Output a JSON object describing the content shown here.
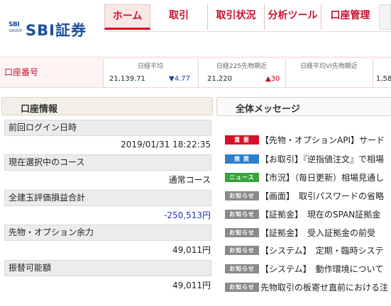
{
  "brand": {
    "mark_text": "SBI",
    "group_text": "GROUP",
    "name": "SBI証券"
  },
  "tabs": [
    {
      "label": "ホーム",
      "active": true
    },
    {
      "label": "取引",
      "active": false
    },
    {
      "label": "取引状況",
      "active": false
    },
    {
      "label": "分析ツール",
      "active": false
    },
    {
      "label": "口座管理",
      "active": false
    }
  ],
  "account": {
    "label": "口座番号"
  },
  "markets": [
    {
      "name": "日経平均",
      "value": "21,139.71",
      "change": "▼4.77",
      "dir": "down"
    },
    {
      "name": "日経225先物期近",
      "value": "21,220",
      "change": "▲30",
      "dir": "up"
    },
    {
      "name": "日経平均VI先物期近",
      "value": "",
      "change": "",
      "dir": ""
    },
    {
      "name": "",
      "value": "1,58",
      "change": "",
      "dir": ""
    }
  ],
  "account_info": {
    "title": "口座情報",
    "rows": [
      {
        "label": "前回ログイン日時",
        "value": "2019/01/31 18:22:35",
        "neg": false
      },
      {
        "label": "現在選択中のコース",
        "value": "通常コース",
        "neg": false
      },
      {
        "label": "全建玉評価損益合計",
        "value": "-250,513円",
        "neg": true
      },
      {
        "label": "先物・オプション余力",
        "value": "49,011円",
        "neg": false
      },
      {
        "label": "振替可能額",
        "value": "49,011円",
        "neg": false
      }
    ]
  },
  "messages": {
    "title": "全体メッセージ",
    "items": [
      {
        "badge": "重 要",
        "badge_color": "#d8102a",
        "text": "【先物・オプションAPI】サード"
      },
      {
        "badge": "推 奨",
        "badge_color": "#2a7fce",
        "text": "【お取引】『逆指値注文』で相場"
      },
      {
        "badge": "ニュース",
        "badge_color": "#3aa23a",
        "text": "【市況】（毎日更新）相場見通し"
      },
      {
        "badge": "お知らせ",
        "badge_color": "#8a8a8a",
        "text": "【画面】　取引パスワードの省略"
      },
      {
        "badge": "お知らせ",
        "badge_color": "#8a8a8a",
        "text": "【証拠金】　現在のSPAN証拠金"
      },
      {
        "badge": "お知らせ",
        "badge_color": "#8a8a8a",
        "text": "【証拠金】　受入証拠金の前受"
      },
      {
        "badge": "お知らせ",
        "badge_color": "#8a8a8a",
        "text": "【システム】　定期・臨時システ"
      },
      {
        "badge": "お知らせ",
        "badge_color": "#8a8a8a",
        "text": "【システム】　動作環境について"
      },
      {
        "badge": "お知らせ",
        "badge_color": "#8a8a8a",
        "text": "先物取引の板寄せ直前における注"
      }
    ]
  },
  "colors": {
    "brand_blue": "#1d4f9c",
    "accent_red": "#c8102e",
    "negative_blue": "#2332b8"
  }
}
